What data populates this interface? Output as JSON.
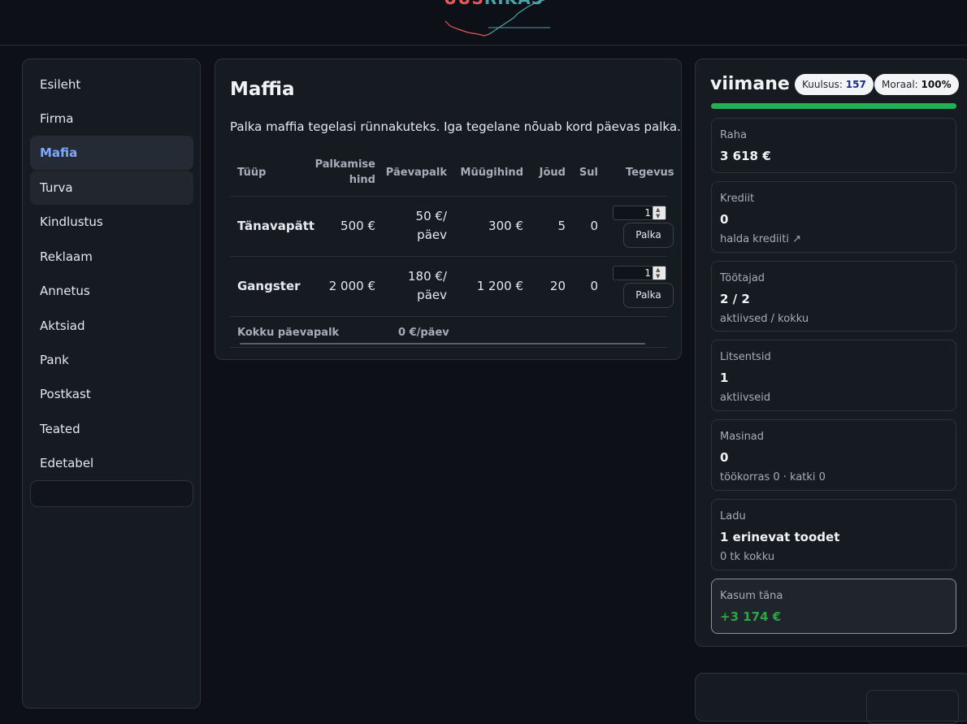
{
  "logo": {
    "text_a": "UUS",
    "text_b": "RIKAS"
  },
  "nav": [
    {
      "label": "Esileht"
    },
    {
      "label": "Firma"
    },
    {
      "label": "Mafia"
    },
    {
      "label": "Turva"
    },
    {
      "label": "Kindlustus"
    },
    {
      "label": "Reklaam"
    },
    {
      "label": "Annetus"
    },
    {
      "label": "Aktsiad"
    },
    {
      "label": "Pank"
    },
    {
      "label": "Postkast"
    },
    {
      "label": "Teated"
    },
    {
      "label": "Edetabel"
    }
  ],
  "main": {
    "title": "Maffia",
    "description": "Palka maffia tegelasi rünnakuteks. Iga tegelane nõuab kord päevas palka.",
    "columns": {
      "type": "Tüüp",
      "hire_price_1": "Palkamise",
      "hire_price_2": "hind",
      "daily_wage": "Päevapalk",
      "sell_price": "Müügihind",
      "power": "Jõud",
      "count": "Sul",
      "action": "Tegevus"
    },
    "rows": [
      {
        "type": "Tänavapätt",
        "hire_price": "500 €",
        "wage_1": "50 €/",
        "wage_2": "päev",
        "sell_price": "300 €",
        "power": "5",
        "count": "0",
        "qty": "1",
        "button": "Palka"
      },
      {
        "type": "Gangster",
        "hire_price": "2 000 €",
        "wage_1": "180 €/",
        "wage_2": "päev",
        "sell_price": "1 200 €",
        "power": "20",
        "count": "0",
        "qty": "1",
        "button": "Palka"
      }
    ],
    "footer": {
      "label": "Kokku päevapalk",
      "value": "0 €/päev"
    }
  },
  "profile": {
    "username": "viimane",
    "fame_label": "Kuulsus:",
    "fame_value": "157",
    "morale_label": "Moraal:",
    "morale_value": "100%",
    "morale_fraction": 1.0,
    "colors": {
      "morale_bar": "#1fb355",
      "profit": "#2fa443",
      "fame_value": "#1b2a8a"
    }
  },
  "stats": {
    "money": {
      "label": "Raha",
      "value": "3 618 €"
    },
    "credit": {
      "label": "Krediit",
      "value": "0",
      "sub": "halda krediiti ↗"
    },
    "workers": {
      "label": "Töötajad",
      "value": "2 / 2",
      "sub": "aktiivsed / kokku"
    },
    "licenses": {
      "label": "Litsentsid",
      "value": "1",
      "sub": "aktiivseid"
    },
    "machines": {
      "label": "Masinad",
      "value": "0",
      "sub": "töökorras 0 · katki 0"
    },
    "warehouse": {
      "label": "Ladu",
      "value": "1 erinevat toodet",
      "sub": "0 tk kokku"
    },
    "profit": {
      "label": "Kasum täna",
      "value": "+3 174 €"
    }
  }
}
